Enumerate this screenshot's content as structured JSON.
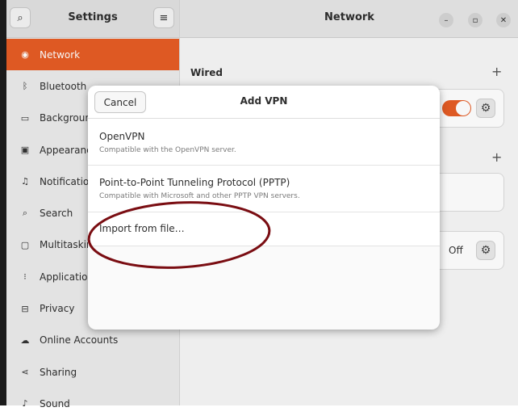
{
  "sidebar": {
    "title": "Settings",
    "items": [
      {
        "label": "Network",
        "icon": "network-icon",
        "glyph": "◉"
      },
      {
        "label": "Bluetooth",
        "icon": "bluetooth-icon",
        "glyph": "ᛒ"
      },
      {
        "label": "Background",
        "icon": "background-icon",
        "glyph": "▭"
      },
      {
        "label": "Appearance",
        "icon": "appearance-icon",
        "glyph": "▣"
      },
      {
        "label": "Notifications",
        "icon": "bell-icon",
        "glyph": "♫"
      },
      {
        "label": "Search",
        "icon": "search-icon",
        "glyph": "⌕"
      },
      {
        "label": "Multitasking",
        "icon": "multitasking-icon",
        "glyph": "▢"
      },
      {
        "label": "Applications",
        "icon": "applications-icon",
        "glyph": "⁝"
      },
      {
        "label": "Privacy",
        "icon": "lock-icon",
        "glyph": "⊟"
      },
      {
        "label": "Online Accounts",
        "icon": "cloud-icon",
        "glyph": "☁"
      },
      {
        "label": "Sharing",
        "icon": "share-icon",
        "glyph": "⋖"
      },
      {
        "label": "Sound",
        "icon": "sound-icon",
        "glyph": "♪"
      }
    ]
  },
  "main": {
    "title": "Network",
    "wired_label": "Wired",
    "off_label": "Off"
  },
  "dialog": {
    "title": "Add VPN",
    "cancel_label": "Cancel",
    "options": [
      {
        "title": "OpenVPN",
        "subtitle": "Compatible with the OpenVPN server."
      },
      {
        "title": "Point-to-Point Tunneling Protocol (PPTP)",
        "subtitle": "Compatible with Microsoft and other PPTP VPN servers."
      },
      {
        "title": "Import from file…",
        "subtitle": ""
      }
    ]
  },
  "colors": {
    "accent": "#e65c25",
    "annotation": "#7a0d12"
  }
}
